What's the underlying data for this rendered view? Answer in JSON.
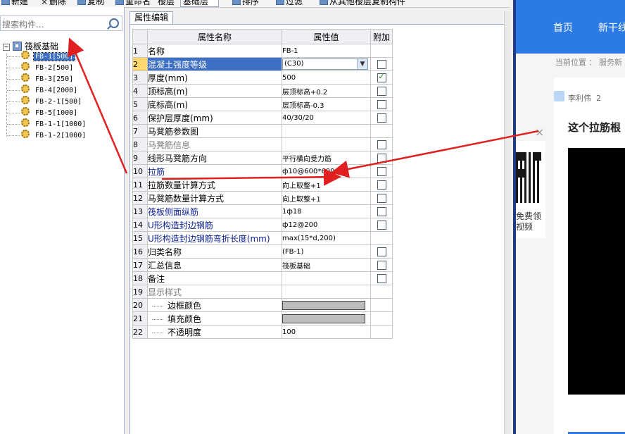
{
  "toolbar": {
    "new_label": "新建",
    "delete_label": "删除",
    "copy_label": "复制",
    "rename_label": "重命名",
    "floor_label": "楼层",
    "floor_value": "基础层",
    "sort_label": "排序",
    "filter_label": "过滤",
    "copy_from_floor_label": "从其他楼层复制构件"
  },
  "search": {
    "placeholder": "搜索构件..."
  },
  "tree": {
    "root_label": "筏板基础",
    "root_expander": "−",
    "items": [
      "FB-1[500]",
      "FB-2[500]",
      "FB-3[250]",
      "FB-4[2000]",
      "FB-2-1[500]",
      "FB-5[1000]",
      "FB-1-1[1000]",
      "FB-1-2[1000]"
    ]
  },
  "editor": {
    "tab_label": "属性编辑",
    "col_name": "属性名称",
    "col_value": "属性值",
    "col_extra": "附加",
    "rows": [
      {
        "num": "1",
        "name": "名称",
        "value": "FB-1"
      },
      {
        "num": "2",
        "name": "混凝土强度等级",
        "value": "(C30)"
      },
      {
        "num": "3",
        "name": "厚度(mm)",
        "value": "500"
      },
      {
        "num": "4",
        "name": "顶标高(m)",
        "value": "层顶标高+0.2"
      },
      {
        "num": "5",
        "name": "底标高(m)",
        "value": "层顶标高-0.3"
      },
      {
        "num": "6",
        "name": "保护层厚度(mm)",
        "value": "40/30/20"
      },
      {
        "num": "7",
        "name": "马凳筋参数图",
        "value": ""
      },
      {
        "num": "8",
        "name": "马凳筋信息",
        "value": ""
      },
      {
        "num": "9",
        "name": "线形马凳筋方向",
        "value": "平行横向受力筋"
      },
      {
        "num": "10",
        "name": "拉筋",
        "value": "ф10@600*600"
      },
      {
        "num": "11",
        "name": "拉筋数量计算方式",
        "value": "向上取整+1"
      },
      {
        "num": "12",
        "name": "马凳筋数量计算方式",
        "value": "向上取整+1"
      },
      {
        "num": "13",
        "name": "筏板侧面纵筋",
        "value": "1ф18"
      },
      {
        "num": "14",
        "name": "U形构造封边钢筋",
        "value": "ф12@200"
      },
      {
        "num": "15",
        "name": "U形构造封边钢筋弯折长度(mm)",
        "value": "max(15*d,200)"
      },
      {
        "num": "16",
        "name": "归类名称",
        "value": "(FB-1)"
      },
      {
        "num": "17",
        "name": "汇总信息",
        "value": "筏板基础"
      },
      {
        "num": "18",
        "name": "备注",
        "value": ""
      },
      {
        "num": "19",
        "name": "显示样式",
        "value": ""
      },
      {
        "num": "20",
        "name": "边框颜色",
        "value": ""
      },
      {
        "num": "21",
        "name": "填充颜色",
        "value": ""
      },
      {
        "num": "22",
        "name": "不透明度",
        "value": "100"
      }
    ],
    "group_expander": "−",
    "dropdown_arrow": "▼"
  },
  "browser": {
    "nav_home": "首页",
    "nav_next": "新干线",
    "breadcrumb": "当前位置 ： 服务新",
    "author": "李利伟",
    "author_suffix": "2",
    "post_title": "这个拉筋根",
    "qr_text_line1": "免费领",
    "qr_text_line2": "视频",
    "close_glyph": "×"
  },
  "colors": {
    "selection": "#3d6fc4",
    "header_value_bg": "#ffcc5e",
    "blue_label": "#0a1f8f",
    "nav_blue": "#2c7be5",
    "annotation_red": "#e02020"
  }
}
